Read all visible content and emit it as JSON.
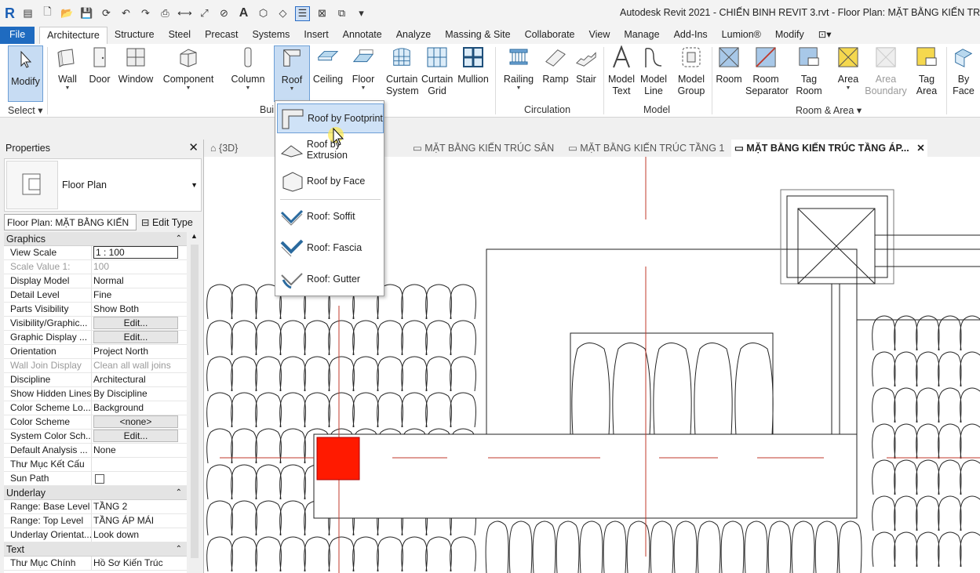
{
  "window": {
    "title": "Autodesk Revit 2021 - CHIẾN BINH REVIT 3.rvt - Floor Plan: MẶT BẰNG KIẾN TRÚC TẦN"
  },
  "qat": {
    "logo": "R",
    "text_icon": "A"
  },
  "tabs": [
    "File",
    "Architecture",
    "Structure",
    "Steel",
    "Precast",
    "Systems",
    "Insert",
    "Annotate",
    "Analyze",
    "Massing & Site",
    "Collaborate",
    "View",
    "Manage",
    "Add-Ins",
    "Lumion®",
    "Modify"
  ],
  "active_tab": "Architecture",
  "ribbon": {
    "modify": "Modify",
    "select": "Select",
    "build_buttons": [
      "Wall",
      "Door",
      "Window",
      "Component",
      "Column",
      "Roof",
      "Ceiling",
      "Floor",
      "Curtain System",
      "Curtain Grid",
      "Mullion"
    ],
    "build_label": "Bui",
    "circulation_buttons": [
      "Railing",
      "Ramp",
      "Stair"
    ],
    "circulation_label": "Circulation",
    "model_buttons": [
      "Model Text",
      "Model Line",
      "Model Group"
    ],
    "model_label": "Model",
    "room_buttons": [
      "Room",
      "Room Separator",
      "Tag Room",
      "Area",
      "Area Boundary",
      "Tag Area"
    ],
    "room_label": "Room & Area",
    "extra_button": "By Face"
  },
  "roof_menu": {
    "items": [
      "Roof by Footprint",
      "Roof by Extrusion",
      "Roof by Face",
      "Roof: Soffit",
      "Roof: Fascia",
      "Roof: Gutter"
    ],
    "highlighted": "Roof by Footprint"
  },
  "properties": {
    "title": "Properties",
    "close": "✕",
    "type_name": "Floor Plan",
    "instance": "Floor Plan: MẶT BẰNG KIẾN",
    "edit_type": "Edit Type",
    "sections": [
      {
        "name": "Graphics",
        "rows": [
          {
            "k": "View Scale",
            "v": "1 : 100",
            "kind": "field"
          },
          {
            "k": "Scale Value    1:",
            "v": "100",
            "kind": "dim"
          },
          {
            "k": "Display Model",
            "v": "Normal"
          },
          {
            "k": "Detail Level",
            "v": "Fine"
          },
          {
            "k": "Parts Visibility",
            "v": "Show Both"
          },
          {
            "k": "Visibility/Graphic...",
            "v": "Edit...",
            "kind": "btn"
          },
          {
            "k": "Graphic Display ...",
            "v": "Edit...",
            "kind": "btn"
          },
          {
            "k": "Orientation",
            "v": "Project North"
          },
          {
            "k": "Wall Join Display",
            "v": "Clean all wall joins",
            "kind": "dim"
          },
          {
            "k": "Discipline",
            "v": "Architectural"
          },
          {
            "k": "Show Hidden Lines",
            "v": "By Discipline"
          },
          {
            "k": "Color Scheme Lo...",
            "v": "Background"
          },
          {
            "k": "Color Scheme",
            "v": "<none>",
            "kind": "btn"
          },
          {
            "k": "System Color Sch...",
            "v": "Edit...",
            "kind": "btn"
          },
          {
            "k": "Default Analysis ...",
            "v": "None"
          },
          {
            "k": "Thư Mục Kết Cấu",
            "v": ""
          },
          {
            "k": "Sun Path",
            "v": "",
            "kind": "check"
          }
        ]
      },
      {
        "name": "Underlay",
        "rows": [
          {
            "k": "Range: Base Level",
            "v": "TẦNG 2"
          },
          {
            "k": "Range: Top Level",
            "v": "TẦNG ÁP MÁI"
          },
          {
            "k": "Underlay Orientat...",
            "v": "Look down"
          }
        ]
      },
      {
        "name": "Text",
        "rows": [
          {
            "k": "Thư Mục Chính",
            "v": "Hồ Sơ Kiến Trúc"
          }
        ]
      }
    ]
  },
  "view_tabs": [
    "{3D}",
    "MẶT BẰNG KIẾN TRÚC SÂN",
    "MẶT BẰNG KIẾN TRÚC TẦNG 1",
    "MẶT BẰNG KIẾN TRÚC TẦNG ÁP..."
  ],
  "active_view_tab": "MẶT BẰNG KIẾN TRÚC TẦNG ÁP...",
  "colors": {
    "accent": "#1f6bc0",
    "selection": "#c7dcf3",
    "marker": "#ff1a00",
    "gridline": "#c0392b"
  }
}
